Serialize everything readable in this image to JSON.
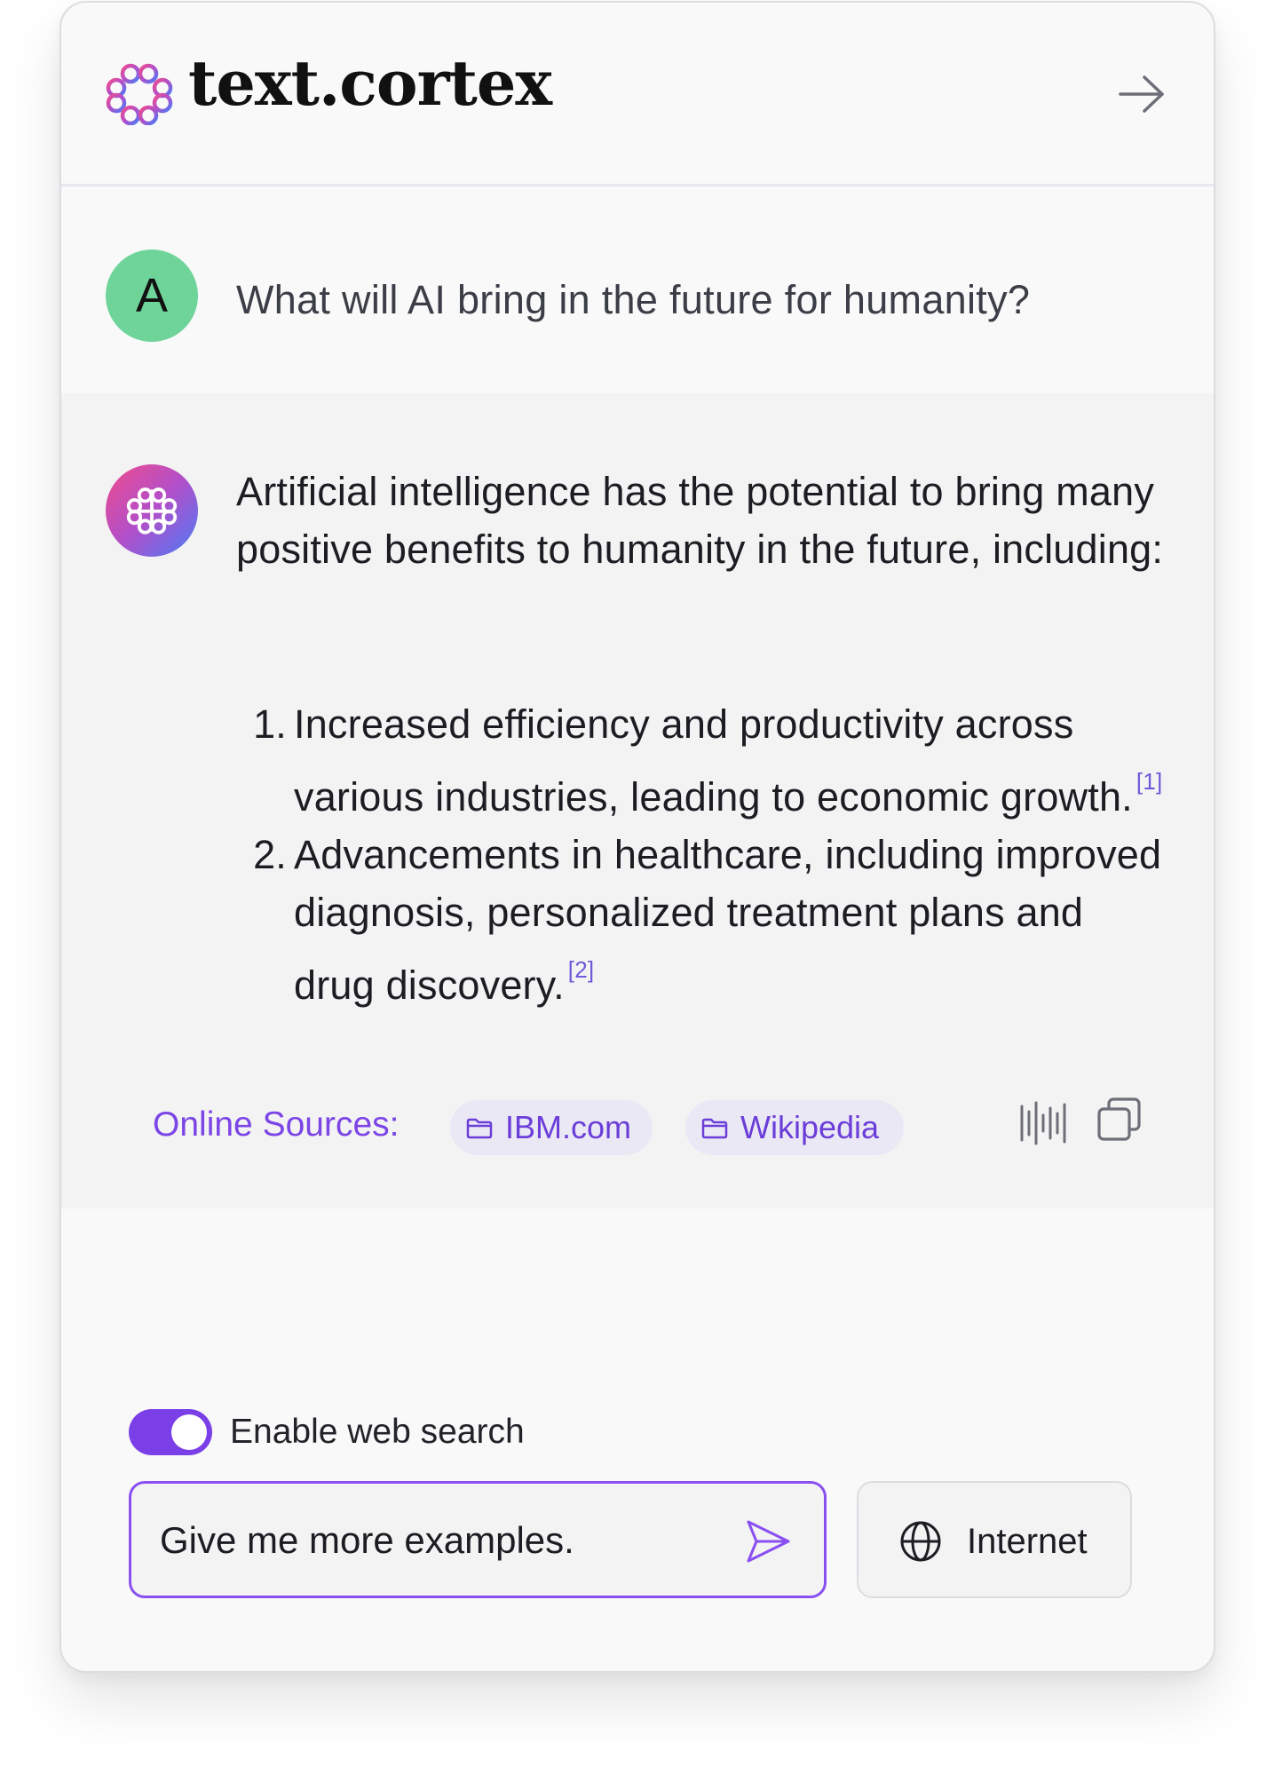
{
  "header": {
    "brand_name": "text.cortex",
    "brand_icon": "brain-logo-icon",
    "collapse_icon": "arrow-right-icon"
  },
  "user_message": {
    "avatar_letter": "A",
    "avatar_color": "#6fd49a",
    "text": "What will AI bring in the future for humanity?"
  },
  "ai_message": {
    "avatar_icon": "brain-icon",
    "intro": "Artificial intelligence has the potential to bring many positive benefits to humanity in the future, including:",
    "items": [
      {
        "number": "1.",
        "text": "Increased efficiency and productivity across various industries, leading to economic growth.",
        "citation": "[1]"
      },
      {
        "number": "2.",
        "text": "Advancements in healthcare, including improved diagnosis, personalized treatment plans and drug discovery.",
        "citation": "[2]"
      }
    ],
    "sources_label": "Online Sources:",
    "sources": [
      {
        "label": "IBM.com",
        "icon": "folder-icon"
      },
      {
        "label": "Wikipedia",
        "icon": "folder-icon"
      }
    ],
    "audio_icon": "audio-waveform-icon",
    "copy_icon": "copy-icon"
  },
  "composer": {
    "web_search_label": "Enable web search",
    "web_search_enabled": true,
    "input_value": "Give me more examples.",
    "send_icon": "send-icon",
    "internet_label": "Internet",
    "internet_icon": "globe-icon"
  },
  "colors": {
    "accent": "#7a3fe6",
    "chip_bg": "#ebe8f5",
    "user_avatar": "#6fd49a"
  }
}
